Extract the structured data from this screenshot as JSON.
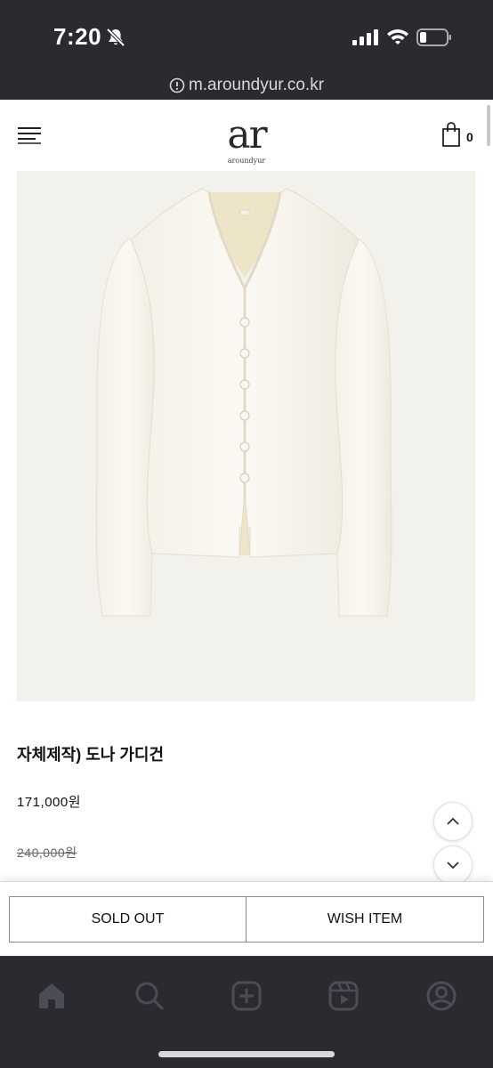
{
  "status_bar": {
    "time": "7:20"
  },
  "browser": {
    "url": "m.aroundyur.co.kr"
  },
  "header": {
    "logo_main": "ar",
    "logo_sub": "aroundyur",
    "cart_count": "0"
  },
  "product": {
    "name": "자체제작) 도나 가디건",
    "price": "171,000원",
    "original_price": "240,000원"
  },
  "actions": {
    "sold_out_label": "SOLD OUT",
    "wish_label": "WISH ITEM"
  },
  "app_nav": {
    "items": [
      "home-icon",
      "search-icon",
      "add-icon",
      "reels-icon",
      "profile-icon"
    ]
  }
}
